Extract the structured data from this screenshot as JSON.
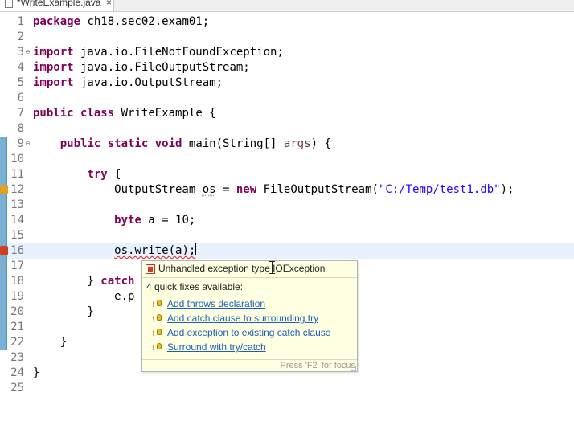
{
  "tab": {
    "label": "*WriteExample.java",
    "close_glyph": "×",
    "icon": "java-file-icon"
  },
  "editor": {
    "lines": [
      {
        "num": "1",
        "fold": "",
        "parts": [
          {
            "t": "package",
            "c": "kw"
          },
          {
            "t": " ch18.sec02.exam01;"
          }
        ]
      },
      {
        "num": "2",
        "fold": "",
        "parts": []
      },
      {
        "num": "3",
        "fold": "⊖",
        "parts": [
          {
            "t": "import",
            "c": "kw"
          },
          {
            "t": " java.io.FileNotFoundException;"
          }
        ]
      },
      {
        "num": "4",
        "fold": "",
        "parts": [
          {
            "t": "import",
            "c": "kw"
          },
          {
            "t": " java.io.FileOutputStream;"
          }
        ]
      },
      {
        "num": "5",
        "fold": "",
        "parts": [
          {
            "t": "import",
            "c": "kw"
          },
          {
            "t": " java.io.OutputStream;"
          }
        ]
      },
      {
        "num": "6",
        "fold": "",
        "parts": []
      },
      {
        "num": "7",
        "fold": "",
        "parts": [
          {
            "t": "public",
            "c": "kw"
          },
          {
            "t": " "
          },
          {
            "t": "class",
            "c": "kw"
          },
          {
            "t": " WriteExample {"
          }
        ]
      },
      {
        "num": "8",
        "fold": "",
        "parts": []
      },
      {
        "num": "9",
        "fold": "⊖",
        "parts": [
          {
            "t": "    "
          },
          {
            "t": "public",
            "c": "kw"
          },
          {
            "t": " "
          },
          {
            "t": "static",
            "c": "kw"
          },
          {
            "t": " "
          },
          {
            "t": "void",
            "c": "kw"
          },
          {
            "t": " main(String[] "
          },
          {
            "t": "args",
            "c": "param"
          },
          {
            "t": ") {"
          }
        ]
      },
      {
        "num": "10",
        "fold": "",
        "parts": []
      },
      {
        "num": "11",
        "fold": "",
        "parts": [
          {
            "t": "        "
          },
          {
            "t": "try",
            "c": "kw"
          },
          {
            "t": " {"
          }
        ]
      },
      {
        "num": "12",
        "fold": "",
        "parts": [
          {
            "t": "            OutputStream "
          },
          {
            "t": "os",
            "c": "under-dotted"
          },
          {
            "t": " = "
          },
          {
            "t": "new",
            "c": "kw"
          },
          {
            "t": " FileOutputStream("
          },
          {
            "t": "\"C:/Temp/test1.db\"",
            "c": "str"
          },
          {
            "t": ");"
          }
        ]
      },
      {
        "num": "13",
        "fold": "",
        "parts": []
      },
      {
        "num": "14",
        "fold": "",
        "parts": [
          {
            "t": "            "
          },
          {
            "t": "byte",
            "c": "kw"
          },
          {
            "t": " a = 10;"
          }
        ]
      },
      {
        "num": "15",
        "fold": "",
        "parts": []
      },
      {
        "num": "16",
        "fold": "",
        "parts": [
          {
            "t": "            "
          },
          {
            "t": "os.write(a);",
            "c": "squig"
          },
          {
            "t": "",
            "c": "caret"
          }
        ]
      },
      {
        "num": "17",
        "fold": "",
        "parts": []
      },
      {
        "num": "18",
        "fold": "",
        "parts": [
          {
            "t": "        } "
          },
          {
            "t": "catch",
            "c": "kw"
          }
        ]
      },
      {
        "num": "19",
        "fold": "",
        "parts": [
          {
            "t": "            e.p"
          }
        ]
      },
      {
        "num": "20",
        "fold": "",
        "parts": [
          {
            "t": "        }"
          }
        ]
      },
      {
        "num": "21",
        "fold": "",
        "parts": []
      },
      {
        "num": "22",
        "fold": "",
        "parts": [
          {
            "t": "    }"
          }
        ]
      },
      {
        "num": "23",
        "fold": "",
        "parts": []
      },
      {
        "num": "24",
        "fold": "",
        "parts": [
          {
            "t": "}"
          }
        ]
      },
      {
        "num": "25",
        "fold": "",
        "parts": []
      }
    ]
  },
  "popup": {
    "title": "Unhandled exception type IOException",
    "subtitle": "4 quick fixes available:",
    "fixes": [
      {
        "label": "Add throws declaration",
        "icon": "quick-fix-icon"
      },
      {
        "label": "Add catch clause to surrounding try",
        "icon": "quick-fix-icon"
      },
      {
        "label": "Add exception to existing catch clause",
        "icon": "quick-fix-icon"
      },
      {
        "label": "Surround with try/catch",
        "icon": "quick-fix-icon"
      }
    ],
    "footer": "Press 'F2' for focus"
  },
  "colors": {
    "keyword": "#7f0055",
    "string": "#2a00ff",
    "link": "#1a5fbf",
    "popup_bg": "#ffffe1",
    "current_line": "#e8f2fe"
  }
}
